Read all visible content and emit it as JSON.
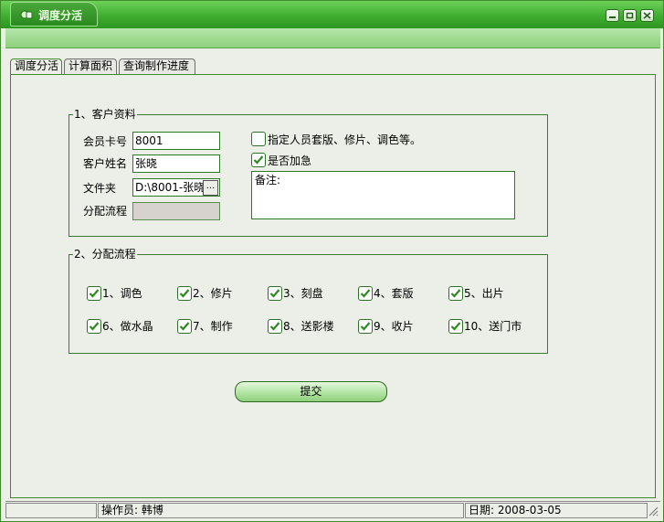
{
  "window": {
    "title": "调度分活",
    "buttons": [
      "minimize",
      "restore",
      "close"
    ]
  },
  "tabs": [
    {
      "label": "调度分活",
      "active": true
    },
    {
      "label": "计算面积",
      "active": false
    },
    {
      "label": "查询制作进度",
      "active": false
    }
  ],
  "customer": {
    "group_title": "1、客户资料",
    "card_label": "会员卡号",
    "card_value": "8001",
    "name_label": "客户姓名",
    "name_value": "张晓",
    "folder_label": "文件夹",
    "folder_value": "D:\\8001-张晓",
    "browse_label": "...",
    "flow_label": "分配流程",
    "flow_value": "",
    "assign_label": "指定人员套版、修片、调色等。",
    "assign_checked": false,
    "urgent_label": "是否加急",
    "urgent_checked": true,
    "notes_label": "备注:"
  },
  "process": {
    "group_title": "2、分配流程",
    "steps": [
      {
        "label": "1、调色",
        "checked": true
      },
      {
        "label": "2、修片",
        "checked": true
      },
      {
        "label": "3、刻盘",
        "checked": true
      },
      {
        "label": "4、套版",
        "checked": true
      },
      {
        "label": "5、出片",
        "checked": true
      },
      {
        "label": "6、做水晶",
        "checked": true
      },
      {
        "label": "7、制作",
        "checked": true
      },
      {
        "label": "8、送影楼",
        "checked": true
      },
      {
        "label": "9、收片",
        "checked": true
      },
      {
        "label": "10、送门市",
        "checked": true
      }
    ]
  },
  "submit_label": "提交",
  "status": {
    "operator": "操作员: 韩博",
    "date": "日期: 2008-03-05"
  },
  "colors": {
    "accent": "#3fae2f",
    "panel_bg": "#ecefe8",
    "border": "#3f8a2a"
  }
}
